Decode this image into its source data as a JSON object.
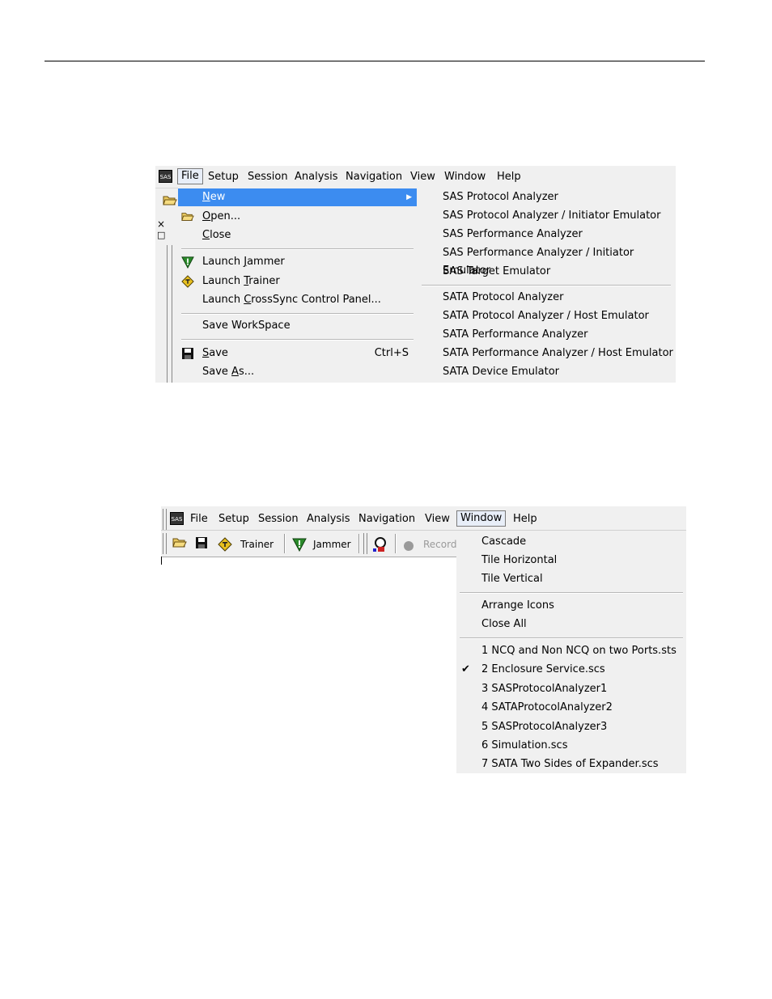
{
  "menubar1": {
    "app_icon": "SAS",
    "items": [
      "File",
      "Setup",
      "Session",
      "Analysis",
      "Navigation",
      "View",
      "Window",
      "Help"
    ]
  },
  "file_menu": {
    "items": [
      {
        "label": "New",
        "icon": "none",
        "has_submenu": true
      },
      {
        "label": "Open...",
        "icon": "open-folder-icon"
      },
      {
        "label": "Close",
        "icon": "none"
      },
      {
        "label": "Launch Jammer",
        "icon": "jammer-icon"
      },
      {
        "label": "Launch Trainer",
        "icon": "trainer-icon"
      },
      {
        "label": "Launch CrossSync Control Panel...",
        "icon": "none"
      },
      {
        "label": "Save  WorkSpace",
        "icon": "none"
      },
      {
        "label": "Save",
        "icon": "floppy-disk-icon",
        "shortcut": "Ctrl+S"
      },
      {
        "label": "Save As...",
        "icon": "none"
      }
    ]
  },
  "new_submenu": {
    "items": [
      "SAS Protocol Analyzer",
      "SAS Protocol Analyzer / Initiator Emulator",
      "SAS Performance Analyzer",
      "SAS Performance Analyzer / Initiator Emulator",
      "SAS Target Emulator",
      "SATA Protocol Analyzer",
      "SATA Protocol Analyzer / Host Emulator",
      "SATA Performance Analyzer",
      "SATA Performance Analyzer / Host Emulator",
      "SATA Device Emulator"
    ]
  },
  "leftstrip": {
    "close_glyph": "×",
    "restore_glyph": "□"
  },
  "menubar2": {
    "app_icon": "SAS",
    "items": [
      "File",
      "Setup",
      "Session",
      "Analysis",
      "Navigation",
      "View",
      "Window",
      "Help"
    ]
  },
  "toolbar2": {
    "trainer_label": "Trainer",
    "jammer_label": "Jammer",
    "record_label": "Record"
  },
  "window_menu": {
    "items": [
      "Cascade",
      "Tile Horizontal",
      "Tile Vertical",
      "Arrange Icons",
      "Close All",
      "1 NCQ and Non NCQ on two Ports.sts",
      "2 Enclosure Service.scs",
      "3 SASProtocolAnalyzer1",
      "4 SATAProtocolAnalyzer2",
      "5 SASProtocolAnalyzer3",
      "6 Simulation.scs",
      "7 SATA Two Sides of Expander.scs"
    ],
    "checked_item": "2 Enclosure Service.scs"
  },
  "colors": {
    "highlight": "#3c8cf0",
    "menu_bg": "#f0f0f0",
    "jammer_green": "#2a8a2a",
    "trainer_yellow": "#e8c020"
  }
}
